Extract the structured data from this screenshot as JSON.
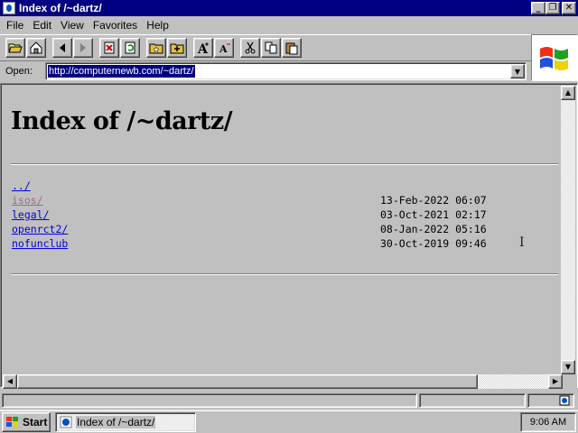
{
  "window": {
    "title": "Index of /~dartz/",
    "buttons": {
      "minimize": "_",
      "maximize": "❐",
      "close": "✕"
    }
  },
  "menu": [
    "File",
    "Edit",
    "View",
    "Favorites",
    "Help"
  ],
  "toolbar": {
    "icons": [
      "open-icon",
      "home-icon",
      "back-icon",
      "forward-icon",
      "stop-icon",
      "refresh-icon",
      "favorites-icon",
      "add-favorite-icon",
      "font-larger-icon",
      "font-smaller-icon",
      "cut-icon",
      "copy-icon",
      "paste-icon"
    ]
  },
  "address": {
    "label": "Open:",
    "value": "http://computernewb.com/~dartz/"
  },
  "page": {
    "heading": "Index of /~dartz/",
    "entries": [
      {
        "name": "../",
        "date": "",
        "visited": false
      },
      {
        "name": "isos/",
        "date": "13-Feb-2022 06:07",
        "visited": true
      },
      {
        "name": "legal/",
        "date": "03-Oct-2021 02:17",
        "visited": false
      },
      {
        "name": "openrct2/",
        "date": "08-Jan-2022 05:16",
        "visited": false
      },
      {
        "name": "nofunclub",
        "date": "30-Oct-2019 09:46",
        "visited": false
      }
    ]
  },
  "taskbar": {
    "start_label": "Start",
    "task_label": "Index of /~dartz/",
    "clock": "9:06 AM"
  },
  "colors": {
    "titlebar": "#000080",
    "link": "#0000e0",
    "visited_link": "#907090",
    "face": "#c0c0c0"
  }
}
